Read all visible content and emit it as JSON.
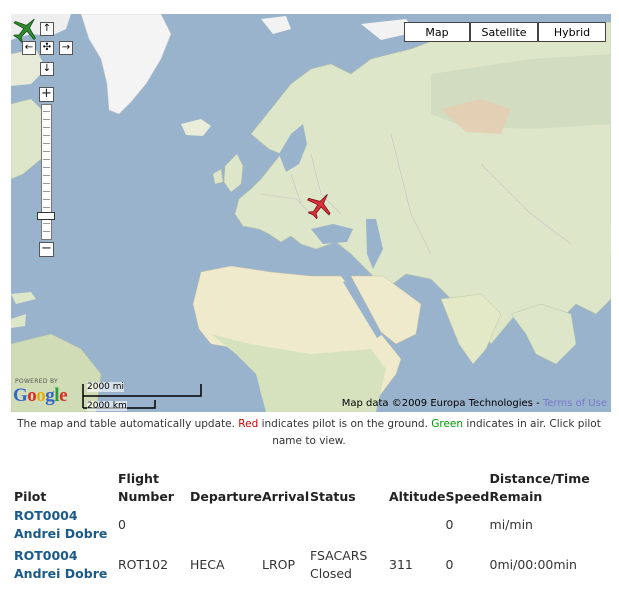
{
  "map": {
    "type_buttons": {
      "map": "Map",
      "satellite": "Satellite",
      "hybrid": "Hybrid"
    },
    "pan": {
      "up": "↑",
      "left": "←",
      "center": "✣",
      "right": "→",
      "down": "↓"
    },
    "zoom": {
      "in": "+",
      "out": "−"
    },
    "logo": {
      "powered_by": "POWERED BY",
      "letters": [
        "G",
        "o",
        "o",
        "g",
        "l",
        "e"
      ]
    },
    "scale": {
      "imperial": "2000 mi",
      "metric": "2000 km"
    },
    "attribution": {
      "text": "Map data ©2009 Europa Technologies - ",
      "terms": "Terms of Use"
    },
    "colors": {
      "water": "#99b3cc",
      "land": "#dde6c8",
      "ice": "#f4f4f4",
      "desert": "#f0eacc",
      "aircraft_ground": "#d9303a",
      "aircraft_air": "#2e8b2e"
    },
    "markers": [
      {
        "name": "green-aircraft-icon",
        "status": "in air"
      },
      {
        "name": "red-aircraft-icon",
        "status": "on ground"
      }
    ]
  },
  "note": {
    "part1": "The map and table automatically update. ",
    "red": "Red",
    "part2": " indicates pilot is on the ground. ",
    "green": "Green",
    "part3": " indicates in air. Click pilot name to view."
  },
  "table": {
    "headers": {
      "pilot": "Pilot",
      "flight": "Flight Number",
      "departure": "Departure",
      "arrival": "Arrival",
      "status": "Status",
      "altitude": "Altitude",
      "speed": "Speed",
      "distance": "Distance/Time Remain"
    },
    "rows": [
      {
        "pilot_id": "ROT0004",
        "pilot_name": "Andrei Dobre",
        "flight": "0",
        "departure": "",
        "arrival": "",
        "status": "",
        "altitude": "",
        "speed": "0",
        "distance": "mi/min"
      },
      {
        "pilot_id": "ROT0004",
        "pilot_name": "Andrei Dobre",
        "flight": "ROT102",
        "departure": "HECA",
        "arrival": "LROP",
        "status": "FSACARS Closed",
        "altitude": "311",
        "speed": "0",
        "distance": "0mi/00:00min"
      }
    ]
  }
}
